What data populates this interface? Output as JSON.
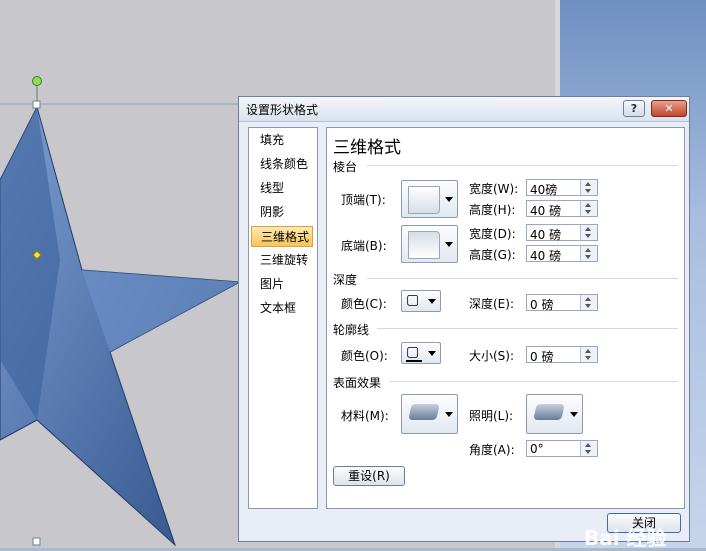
{
  "dialog": {
    "title": "设置形状格式",
    "help_label": "?",
    "close_x_label": "✕",
    "nav": [
      "填充",
      "线条颜色",
      "线型",
      "阴影",
      "三维格式",
      "三维旋转",
      "图片",
      "文本框"
    ],
    "active_nav": "三维格式",
    "heading": "三维格式",
    "bevel": {
      "section": "棱台",
      "top_label": "顶端(T):",
      "bottom_label": "底端(B):",
      "top_width_label": "宽度(W):",
      "top_width_value": "40磅",
      "top_height_label": "高度(H):",
      "top_height_value": "40 磅",
      "bottom_width_label": "宽度(D):",
      "bottom_width_value": "40 磅",
      "bottom_height_label": "高度(G):",
      "bottom_height_value": "40 磅"
    },
    "depth": {
      "section": "深度",
      "color_label": "颜色(C):",
      "depth_label": "深度(E):",
      "depth_value": "0 磅"
    },
    "contour": {
      "section": "轮廓线",
      "color_label": "颜色(O):",
      "size_label": "大小(S):",
      "size_value": "0 磅"
    },
    "surface": {
      "section": "表面效果",
      "material_label": "材料(M):",
      "lighting_label": "照明(L):",
      "angle_label": "角度(A):",
      "angle_value": "0°"
    },
    "reset_label": "重设(R)",
    "close_label": "关闭"
  },
  "watermark": "Bai 经验",
  "colors": {
    "star": "#4d74ad",
    "accent_orange": "#f7c65b"
  }
}
